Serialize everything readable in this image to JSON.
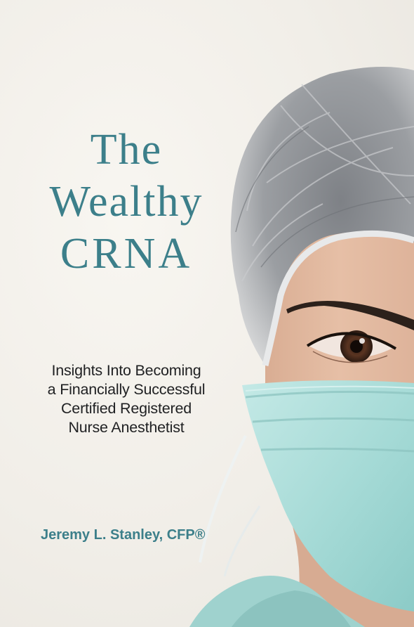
{
  "book": {
    "title_lines": [
      "The",
      "Wealthy",
      "CRNA"
    ],
    "subtitle_lines": [
      "Insights Into Becoming",
      "a Financially Successful",
      "Certified Registered",
      "Nurse Anesthetist"
    ],
    "author": "Jeremy L. Stanley, CFP®"
  },
  "colors": {
    "title": "#3c7f8a",
    "subtitle": "#1f2022",
    "background": "#f3f1ec",
    "mask": "#a9dcd8",
    "cap": "#8d9094"
  }
}
